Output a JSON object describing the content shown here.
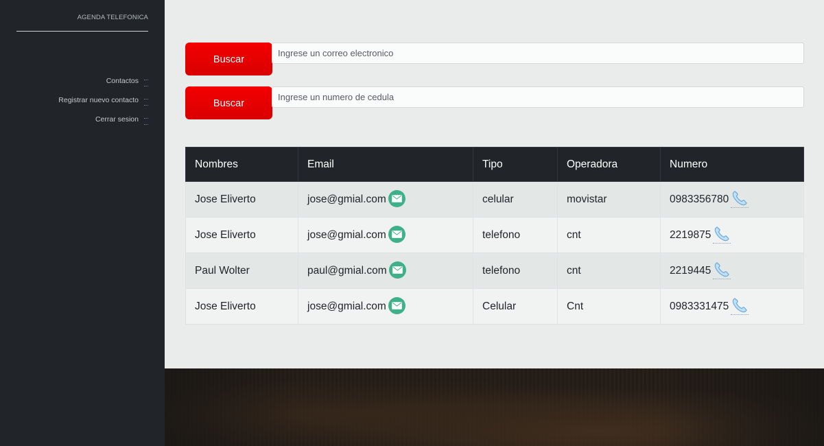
{
  "sidebar": {
    "brand": "AGENDA TELEFONICA",
    "items": [
      {
        "label": "Contactos"
      },
      {
        "label": "Registrar nuevo contacto"
      },
      {
        "label": "Cerrar sesion"
      }
    ]
  },
  "search": {
    "email": {
      "button_label": "Buscar",
      "placeholder": "Ingrese un correo electronico",
      "value": ""
    },
    "cedula": {
      "button_label": "Buscar",
      "placeholder": "Ingrese un numero de cedula",
      "value": ""
    }
  },
  "table": {
    "headers": [
      "Nombres",
      "Email",
      "Tipo",
      "Operadora",
      "Numero"
    ],
    "rows": [
      {
        "nombres": "Jose Eliverto",
        "email": "jose@gmial.com",
        "tipo": "celular",
        "operadora": "movistar",
        "numero": "0983356780"
      },
      {
        "nombres": "Jose Eliverto",
        "email": "jose@gmial.com",
        "tipo": "telefono",
        "operadora": "cnt",
        "numero": "2219875"
      },
      {
        "nombres": "Paul Wolter",
        "email": "paul@gmial.com",
        "tipo": "telefono",
        "operadora": "cnt",
        "numero": "2219445"
      },
      {
        "nombres": "Jose Eliverto",
        "email": "jose@gmial.com",
        "tipo": "Celular",
        "operadora": "Cnt",
        "numero": "0983331475"
      }
    ]
  },
  "icons": {
    "mail": "envelope-icon",
    "phone": "phone-icon"
  },
  "colors": {
    "accent": "#e60000",
    "sidebar": "#212529",
    "panel": "#e9eceb",
    "mail_icon_bg": "#3fb08a",
    "phone_icon": "#7fb9e6"
  }
}
